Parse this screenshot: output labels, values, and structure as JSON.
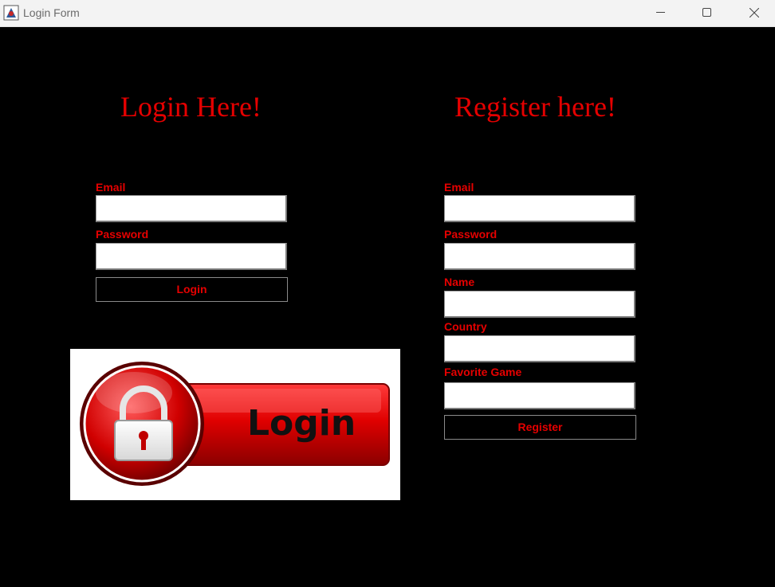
{
  "window": {
    "title": "Login Form",
    "app_icon": "java-app-icon",
    "controls": [
      "minimize-icon",
      "maximize-icon",
      "close-icon"
    ]
  },
  "login": {
    "heading": "Login Here!",
    "email_label": "Email",
    "email_value": "",
    "password_label": "Password",
    "password_value": "",
    "button_label": "Login"
  },
  "register": {
    "heading": "Register here!",
    "email_label": "Email",
    "email_value": "",
    "password_label": "Password",
    "password_value": "",
    "name_label": "Name",
    "name_value": "",
    "country_label": "Country",
    "country_value": "",
    "game_label": "Favorite Game",
    "game_value": "",
    "button_label": "Register"
  },
  "banner": {
    "text": "Login",
    "icon": "padlock-icon"
  },
  "colors": {
    "accent": "#e50000",
    "background": "#000000",
    "titlebar": "#f3f3f3"
  }
}
